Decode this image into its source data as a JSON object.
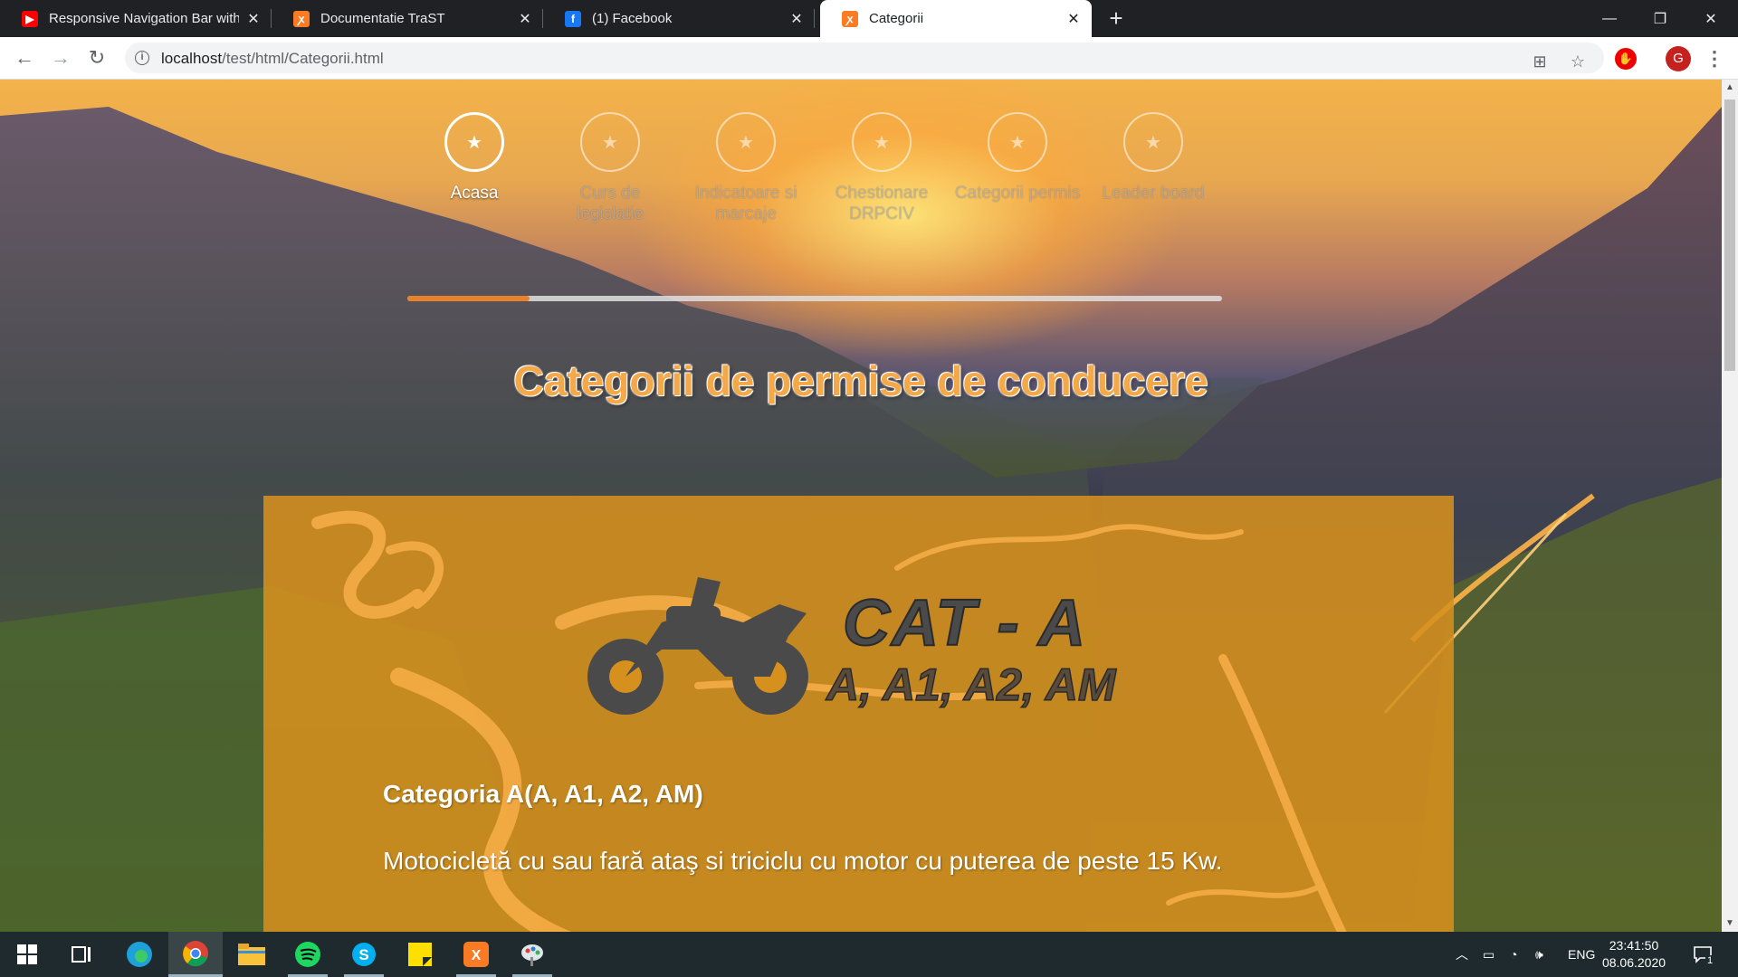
{
  "browser": {
    "tabs": [
      {
        "title": "Responsive Navigation Bar with H",
        "favicon": "youtube-icon",
        "color": "#ff0000"
      },
      {
        "title": "Documentatie TraST",
        "favicon": "xampp-icon",
        "color": "#fb7a24"
      },
      {
        "title": "(1) Facebook",
        "favicon": "facebook-icon",
        "color": "#1877f2"
      },
      {
        "title": "Categorii",
        "favicon": "xampp-icon",
        "color": "#fb7a24"
      }
    ],
    "active_tab": 3,
    "url_host": "localhost",
    "url_path": "/test/html/Categorii.html",
    "profile_initial": "G"
  },
  "page": {
    "nav": [
      {
        "label": "Acasa",
        "icon": "star-icon",
        "active": true
      },
      {
        "label": "Curs de legislatie",
        "icon": "star-icon",
        "active": false
      },
      {
        "label": "Indicatoare si marcaje",
        "icon": "star-icon",
        "active": false
      },
      {
        "label": "Chestionare DRPCIV",
        "icon": "star-icon",
        "active": false
      },
      {
        "label": "Categorii permis",
        "icon": "star-icon",
        "active": false
      },
      {
        "label": "Leader board",
        "icon": "star-icon",
        "active": false
      }
    ],
    "progress": 0.15,
    "heading": "Categorii de permise de conducere",
    "card": {
      "logo_cat": "CAT - A",
      "logo_sub": "A, A1, A2, AM",
      "title": "Categoria A(A, A1, A2, AM)",
      "description": "Motocicletă cu sau fară ataş si triciclu cu motor cu puterea de peste 15 Kw.",
      "color": "#d6901e"
    }
  },
  "taskbar": {
    "apps": [
      "windows-start-icon",
      "task-view-icon",
      "edge-icon",
      "chrome-icon",
      "file-explorer-icon",
      "spotify-icon",
      "skype-icon",
      "sticky-notes-icon",
      "xampp-icon",
      "paint-icon"
    ],
    "language": "ENG",
    "time": "23:41:50",
    "date": "08.06.2020",
    "notifications": "1"
  }
}
